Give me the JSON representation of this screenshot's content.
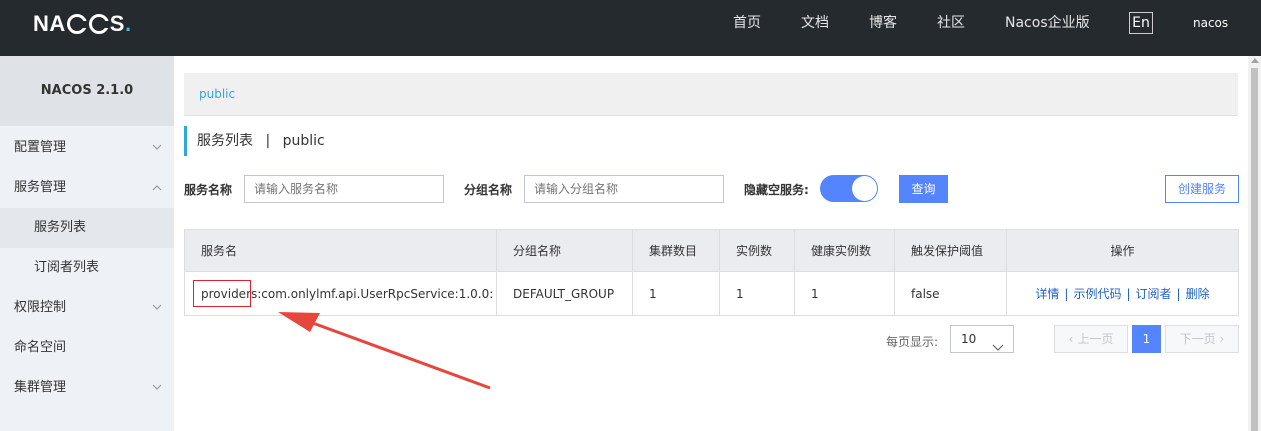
{
  "header": {
    "logo_text": "NACOS.",
    "nav": [
      "首页",
      "文档",
      "博客",
      "社区",
      "Nacos企业版"
    ],
    "lang": "En",
    "user": "nacos"
  },
  "sidebar": {
    "title": "NACOS 2.1.0",
    "items": [
      {
        "label": "配置管理",
        "chevron": "down"
      },
      {
        "label": "服务管理",
        "chevron": "up"
      },
      {
        "label": "服务列表",
        "sub": true,
        "active": true
      },
      {
        "label": "订阅者列表",
        "sub": true
      },
      {
        "label": "权限控制",
        "chevron": "down"
      },
      {
        "label": "命名空间"
      },
      {
        "label": "集群管理",
        "chevron": "down"
      }
    ]
  },
  "breadcrumb": "public",
  "page_title": {
    "main": "服务列表",
    "separator": "|",
    "namespace": "public"
  },
  "filters": {
    "service_name_label": "服务名称",
    "service_name_placeholder": "请输入服务名称",
    "group_name_label": "分组名称",
    "group_name_placeholder": "请输入分组名称",
    "hide_empty_label": "隐藏空服务:",
    "hide_empty_on": true,
    "query_button": "查询",
    "create_button": "创建服务"
  },
  "table": {
    "headers": [
      "服务名",
      "分组名称",
      "集群数目",
      "实例数",
      "健康实例数",
      "触发保护阈值",
      "操作"
    ],
    "rows": [
      {
        "service_name": "providers:com.onlylmf.api.UserRpcService:1.0.0:",
        "group": "DEFAULT_GROUP",
        "clusters": "1",
        "instances": "1",
        "healthy": "1",
        "threshold": "false",
        "actions": [
          "详情",
          "示例代码",
          "订阅者",
          "删除"
        ]
      }
    ]
  },
  "pagination": {
    "page_size_label": "每页显示:",
    "page_size": "10",
    "prev": "上一页",
    "current": "1",
    "next": "下一页"
  },
  "colors": {
    "topbar": "#252a2f",
    "accent": "#5584ff",
    "link": "#1e63c6",
    "highlight": "#d9232d",
    "arrow": "#e8453c"
  },
  "annotation": {
    "icon": "red-arrow-icon"
  }
}
